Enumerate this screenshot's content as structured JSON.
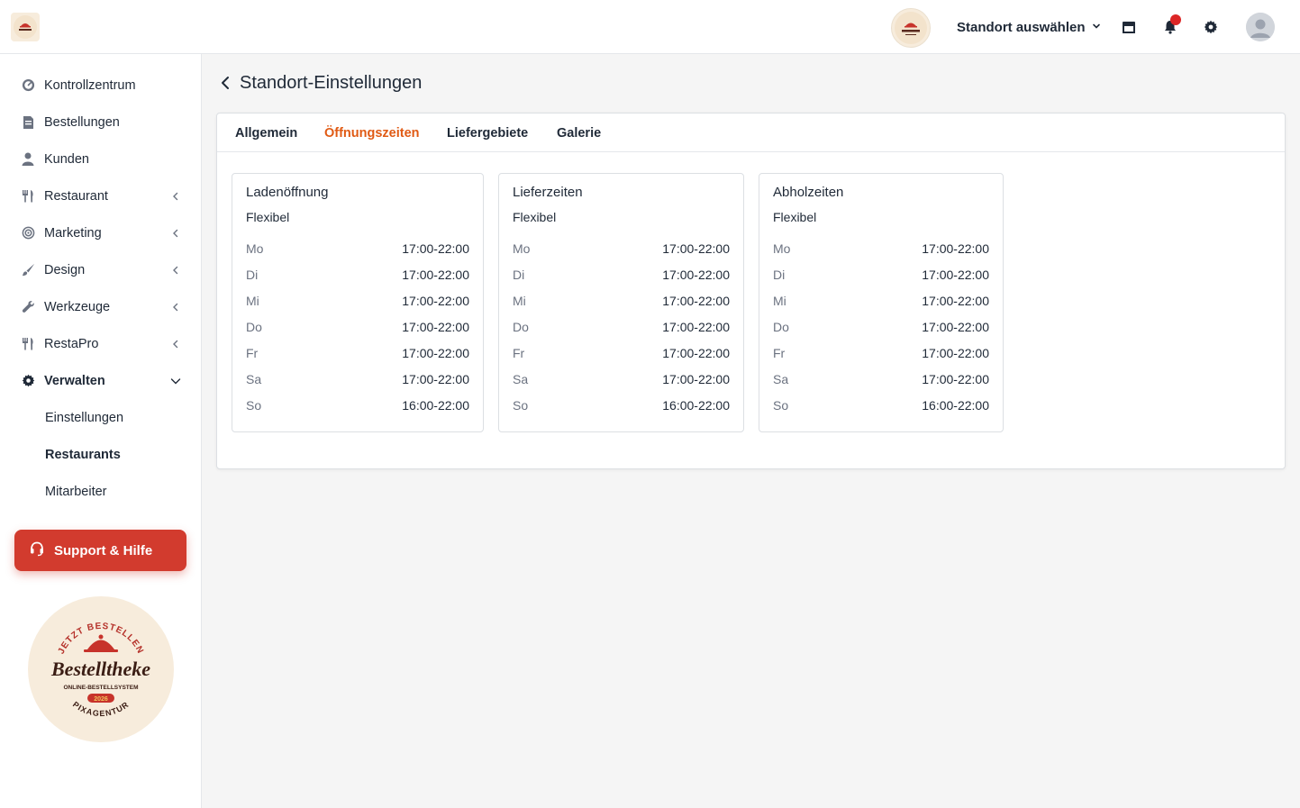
{
  "header": {
    "location_select_label": "Standort auswählen",
    "icons": [
      "store-icon",
      "bell-icon",
      "gear-icon",
      "user-avatar"
    ]
  },
  "sidebar": {
    "items": [
      {
        "label": "Kontrollzentrum",
        "icon": "dashboard-icon",
        "has_chevron": false
      },
      {
        "label": "Bestellungen",
        "icon": "receipt-icon",
        "has_chevron": false
      },
      {
        "label": "Kunden",
        "icon": "user-icon",
        "has_chevron": false
      },
      {
        "label": "Restaurant",
        "icon": "utensils-icon",
        "has_chevron": true
      },
      {
        "label": "Marketing",
        "icon": "target-icon",
        "has_chevron": true
      },
      {
        "label": "Design",
        "icon": "brush-icon",
        "has_chevron": true
      },
      {
        "label": "Werkzeuge",
        "icon": "wrench-icon",
        "has_chevron": true
      },
      {
        "label": "RestaPro",
        "icon": "utensils-icon",
        "has_chevron": true
      },
      {
        "label": "Verwalten",
        "icon": "gear-icon",
        "has_chevron": true,
        "expanded": true
      }
    ],
    "sub_items": [
      {
        "label": "Einstellungen",
        "active": false
      },
      {
        "label": "Restaurants",
        "active": true
      },
      {
        "label": "Mitarbeiter",
        "active": false
      }
    ],
    "support_label": "Support & Hilfe",
    "badge": {
      "arc_top": "JETZT BESTELLEN",
      "brand": "Bestelltheke",
      "tagline": "ONLINE-BESTELLSYSTEM",
      "year": "2026",
      "arc_bottom": "PIXAGENTUR"
    }
  },
  "main": {
    "title": "Standort-Einstellungen",
    "tabs": [
      {
        "label": "Allgemein",
        "active": false
      },
      {
        "label": "Öffnungszeiten",
        "active": true
      },
      {
        "label": "Liefergebiete",
        "active": false
      },
      {
        "label": "Galerie",
        "active": false
      }
    ],
    "boxes": [
      {
        "title": "Ladenöffnung",
        "mode": "Flexibel",
        "rows": [
          {
            "day": "Mo",
            "time": "17:00-22:00"
          },
          {
            "day": "Di",
            "time": "17:00-22:00"
          },
          {
            "day": "Mi",
            "time": "17:00-22:00"
          },
          {
            "day": "Do",
            "time": "17:00-22:00"
          },
          {
            "day": "Fr",
            "time": "17:00-22:00"
          },
          {
            "day": "Sa",
            "time": "17:00-22:00"
          },
          {
            "day": "So",
            "time": "16:00-22:00"
          }
        ]
      },
      {
        "title": "Lieferzeiten",
        "mode": "Flexibel",
        "rows": [
          {
            "day": "Mo",
            "time": "17:00-22:00"
          },
          {
            "day": "Di",
            "time": "17:00-22:00"
          },
          {
            "day": "Mi",
            "time": "17:00-22:00"
          },
          {
            "day": "Do",
            "time": "17:00-22:00"
          },
          {
            "day": "Fr",
            "time": "17:00-22:00"
          },
          {
            "day": "Sa",
            "time": "17:00-22:00"
          },
          {
            "day": "So",
            "time": "16:00-22:00"
          }
        ]
      },
      {
        "title": "Abholzeiten",
        "mode": "Flexibel",
        "rows": [
          {
            "day": "Mo",
            "time": "17:00-22:00"
          },
          {
            "day": "Di",
            "time": "17:00-22:00"
          },
          {
            "day": "Mi",
            "time": "17:00-22:00"
          },
          {
            "day": "Do",
            "time": "17:00-22:00"
          },
          {
            "day": "Fr",
            "time": "17:00-22:00"
          },
          {
            "day": "Sa",
            "time": "17:00-22:00"
          },
          {
            "day": "So",
            "time": "16:00-22:00"
          }
        ]
      }
    ]
  },
  "colors": {
    "accent": "#e05a14",
    "support": "#d23b2e",
    "notification": "#dc2626"
  }
}
